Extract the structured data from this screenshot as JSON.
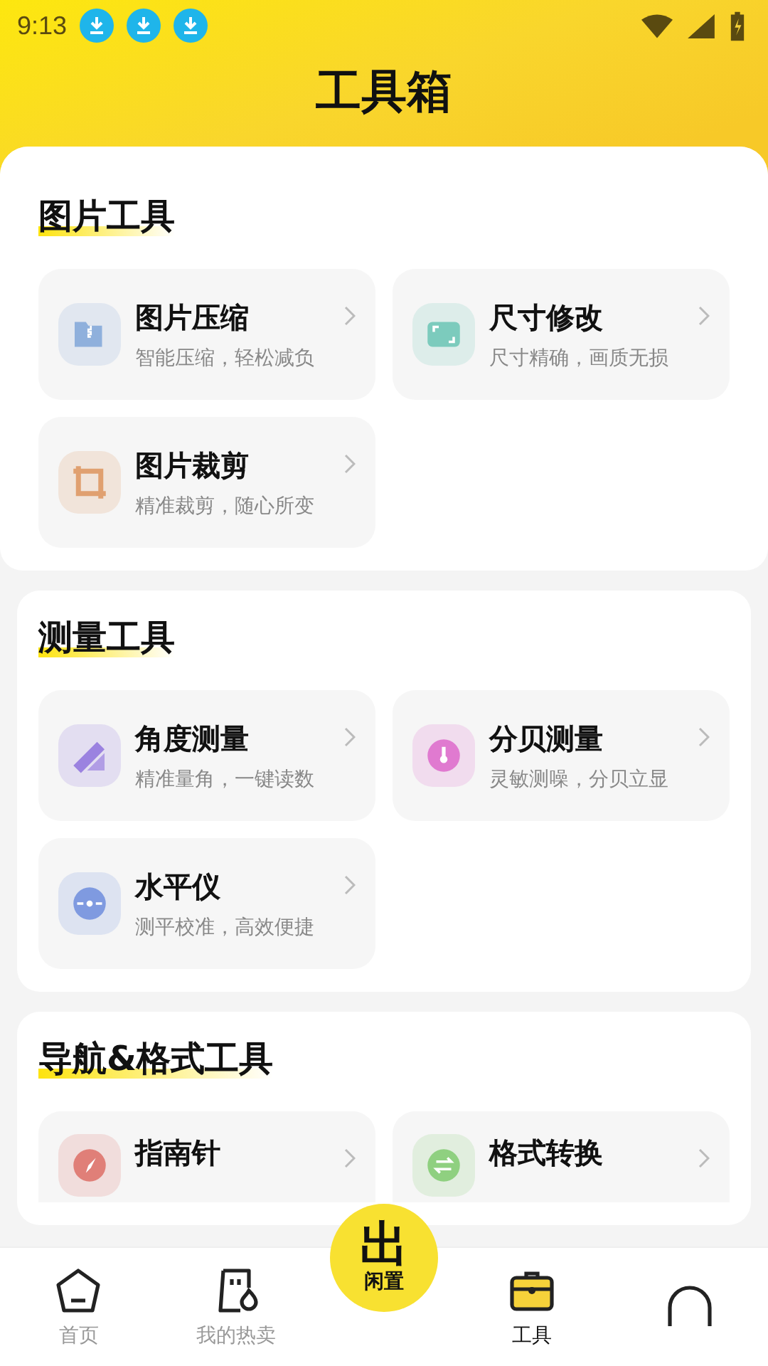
{
  "status_bar": {
    "time": "9:13",
    "notifications": [
      {
        "kind": "download"
      },
      {
        "kind": "download"
      },
      {
        "kind": "download"
      }
    ]
  },
  "title": "工具箱",
  "sections": [
    {
      "title": "图片工具",
      "tools": [
        {
          "kind": "compress",
          "color": "#8fb0dc",
          "name": "图片压缩",
          "desc": "智能压缩，轻松减负"
        },
        {
          "kind": "resize",
          "color": "#7ccbbd",
          "name": "尺寸修改",
          "desc": "尺寸精确，画质无损"
        },
        {
          "kind": "crop",
          "color": "#e0a070",
          "name": "图片裁剪",
          "desc": "精准裁剪，随心所变"
        }
      ]
    },
    {
      "title": "测量工具",
      "tools": [
        {
          "kind": "angle",
          "color": "#9b82e0",
          "name": "角度测量",
          "desc": "精准量角，一键读数"
        },
        {
          "kind": "decibel",
          "color": "#e07ad0",
          "name": "分贝测量",
          "desc": "灵敏测噪，分贝立显"
        },
        {
          "kind": "level",
          "color": "#7f9ae0",
          "name": "水平仪",
          "desc": "测平校准，高效便捷"
        }
      ]
    },
    {
      "title": "导航&格式工具",
      "tools": [
        {
          "kind": "compass",
          "color": "#e07f78",
          "name": "指南针"
        },
        {
          "kind": "convert",
          "color": "#8fd080",
          "name": "格式转换"
        }
      ]
    }
  ],
  "nav": [
    {
      "kind": "home",
      "label": "首页",
      "selected": false
    },
    {
      "kind": "hot",
      "label": "我的热卖",
      "selected": false
    },
    {
      "kind": "post",
      "glyph": "出",
      "label": "闲置",
      "selected": false
    },
    {
      "kind": "tools",
      "label": "工具",
      "selected": true
    },
    {
      "kind": "profile",
      "selected": false
    }
  ]
}
